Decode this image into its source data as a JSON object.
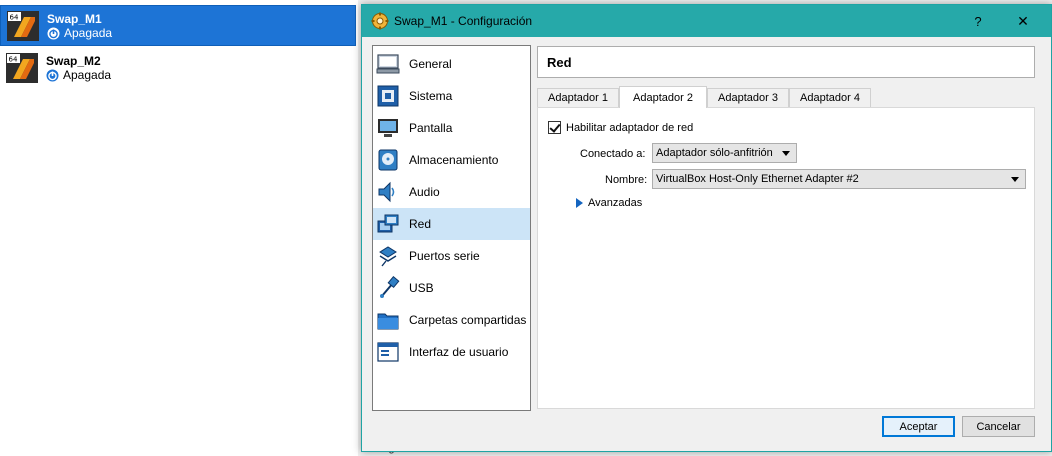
{
  "vm_list": [
    {
      "name": "Swap_M1",
      "state": "Apagada",
      "selected": true
    },
    {
      "name": "Swap_M2",
      "state": "Apagada",
      "selected": false
    }
  ],
  "vm_icon_badge": "64",
  "background_peek_text": "Ninguno",
  "dialog": {
    "title": "Swap_M1 - Configuración",
    "help_label": "?",
    "close_label": "✕"
  },
  "categories": [
    {
      "label": "General",
      "icon": "general-icon"
    },
    {
      "label": "Sistema",
      "icon": "system-icon"
    },
    {
      "label": "Pantalla",
      "icon": "display-icon"
    },
    {
      "label": "Almacenamiento",
      "icon": "storage-icon"
    },
    {
      "label": "Audio",
      "icon": "audio-icon"
    },
    {
      "label": "Red",
      "icon": "network-icon",
      "active": true
    },
    {
      "label": "Puertos serie",
      "icon": "serial-ports-icon"
    },
    {
      "label": "USB",
      "icon": "usb-icon"
    },
    {
      "label": "Carpetas compartidas",
      "icon": "shared-folders-icon"
    },
    {
      "label": "Interfaz de usuario",
      "icon": "user-interface-icon"
    }
  ],
  "network": {
    "section_title": "Red",
    "tabs": [
      "Adaptador 1",
      "Adaptador 2",
      "Adaptador 3",
      "Adaptador 4"
    ],
    "active_tab": "Adaptador 2",
    "enable_label": "Habilitar adaptador de red",
    "enabled": true,
    "attached_label": "Conectado a:",
    "attached_value": "Adaptador sólo-anfitrión",
    "name_label": "Nombre:",
    "name_value": "VirtualBox Host-Only Ethernet Adapter #2",
    "advanced_label": "Avanzadas"
  },
  "buttons": {
    "ok": "Aceptar",
    "cancel": "Cancelar"
  },
  "colors": {
    "titlebar": "#26a9a9",
    "selection": "#1d74d6",
    "category_active": "#cce4f7",
    "primary_border": "#0078d7"
  }
}
